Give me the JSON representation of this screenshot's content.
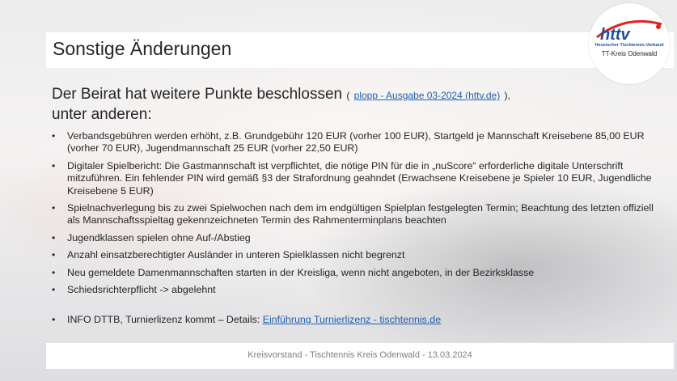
{
  "slide": {
    "title": "Sonstige Änderungen",
    "logo": {
      "text": "httv",
      "subtitle": "Hessischer Tischtennis-Verband",
      "kreis": "TT-Kreis Odenwald"
    },
    "headline": {
      "text": "Der Beirat hat weitere Punkte beschlossen",
      "paren_open": "(",
      "link": "plopp - Ausgabe 03-2024 (httv.de)",
      "paren_close": "),",
      "line2": "unter anderen:"
    },
    "bullets": [
      {
        "bold": "Verbandsgebühren werden erhöht",
        "text": ", z.B. Grundgebühr 120 EUR (vorher 100 EUR), Startgeld je Mannschaft Kreisebene 85,00 EUR (vorher 70 EUR), Jugendmannschaft 25 EUR (vorher 22,50 EUR)"
      },
      {
        "bold": "Digitaler Spielbericht",
        "text": ": Die Gastmannschaft ist verpflichtet, die nötige PIN für die in „nuScore“ erforderliche digitale Unterschrift mitzuführen. Ein fehlender PIN wird gemäß §3 der Strafordnung geahndet (Erwachsene Kreisebene je Spieler 10 EUR, Jugendliche Kreisebene 5 EUR)"
      },
      {
        "bold": "Spielnachverlegung",
        "text": " bis zu zwei Spielwochen nach dem im endgültigen Spielplan festgelegten Termin; Beachtung des letzten offiziell als Mannschaftsspieltag gekennzeichneten Termin des Rahmenterminplans beachten"
      },
      {
        "bold": "Jugendklassen",
        "text": " spielen ohne Auf-/Abstieg"
      },
      {
        "bold": "Anzahl einsatzberechtigter Ausländer",
        "text": " in unteren Spielklassen nicht begrenzt"
      },
      {
        "bold": "Neu gemeldete Damenmannschaften",
        "text": " starten in der Kreisliga, wenn nicht angeboten, in der Bezirksklasse"
      },
      {
        "bold": "Schiedsrichterpflicht",
        "text": " -> abgelehnt"
      }
    ],
    "bullet_char": "•",
    "info": {
      "prefix": "INFO DTTB, ",
      "bold": "Turnierlizenz",
      "middle": " kommt – Details: ",
      "link": "Einführung Turnierlizenz - tischtennis.de"
    },
    "footer": "Kreisvorstand  -  Tischtennis Kreis Odenwald  -  13.03.2024",
    "colors": {
      "link": "#1f5fb0",
      "logo_blue": "#1f4e9a",
      "logo_red": "#e2231a",
      "footer_text": "#7f7f7f"
    }
  }
}
